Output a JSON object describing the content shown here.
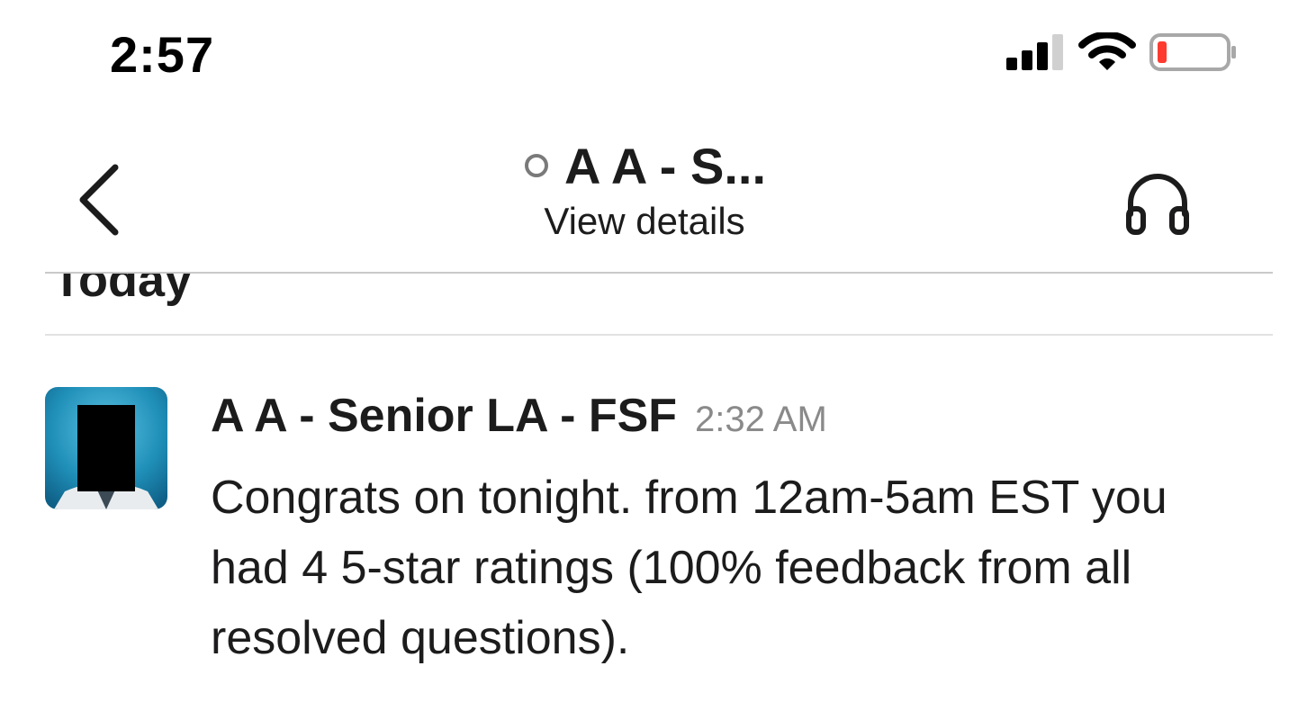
{
  "status_bar": {
    "time": "2:57",
    "icons": [
      "cellular-signal-icon",
      "wifi-icon",
      "battery-low-icon"
    ],
    "battery_color": "#ff3b30"
  },
  "header": {
    "title": "A A - S...",
    "subtitle": "View details",
    "presence_status": "away",
    "icons": [
      "back-chevron-icon",
      "presence-circle-icon",
      "headphones-icon"
    ]
  },
  "day_divider": {
    "label": "Today"
  },
  "message": {
    "sender": "A A - Senior LA - FSF",
    "timestamp": "2:32 AM",
    "text": "Congrats on tonight. from 12am-5am EST you had 4 5-star ratings (100% feedback from all resolved questions)."
  },
  "colors": {
    "text": "#1d1c1d",
    "timestamp": "#8a8a8a",
    "avatar_bg": "#1f8fb8",
    "divider": "#c9c9c9"
  }
}
